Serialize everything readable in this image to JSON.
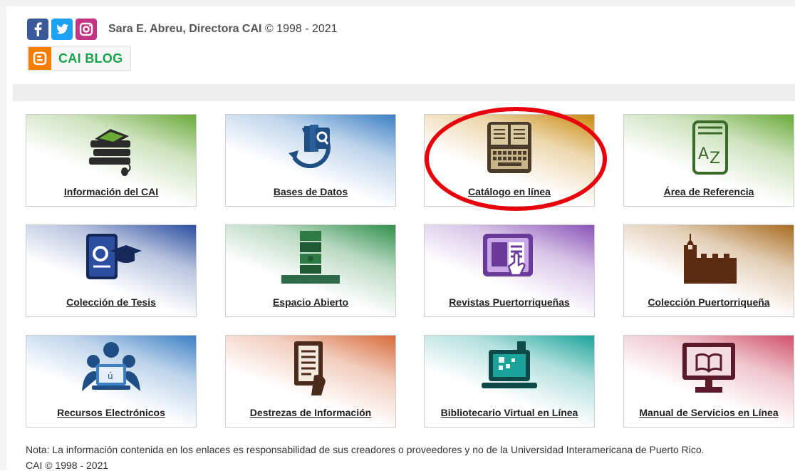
{
  "header": {
    "social": [
      {
        "name": "facebook-icon",
        "glyph": "f",
        "color": "#3b5998"
      },
      {
        "name": "twitter-icon",
        "color": "#1da1f2"
      },
      {
        "name": "instagram-icon",
        "color": "#c13584"
      }
    ],
    "credit_name": "Sara E. Abreu, Directora CAI",
    "credit_years": "© 1998 - 2021",
    "blog_label": "CAI BLOG"
  },
  "tiles": [
    {
      "label": "Información del CAI",
      "icon": "books-mouse-icon",
      "color": "#6aaa3a"
    },
    {
      "label": "Bases de Datos",
      "icon": "database-search-icon",
      "color": "#3b7fc4"
    },
    {
      "label": "Catálogo en línea",
      "icon": "book-keyboard-icon",
      "color": "#c98a0d"
    },
    {
      "label": "Área de Referencia",
      "icon": "dictionary-az-icon",
      "color": "#6aaa3a"
    },
    {
      "label": "Colección de Tesis",
      "icon": "thesis-gradcap-icon",
      "color": "#2b4ea0"
    },
    {
      "label": "Espacio Abierto",
      "icon": "open-space-icon",
      "color": "#2f8f4a"
    },
    {
      "label": "Revistas Puertorriqueñas",
      "icon": "magazine-touch-icon",
      "color": "#8a52b8"
    },
    {
      "label": "Colección Puertorriqueña",
      "icon": "castle-icon",
      "color": "#a86a1e"
    },
    {
      "label": "Recursos Electrónicos",
      "icon": "users-laptop-icon",
      "color": "#3b7fc4"
    },
    {
      "label": "Destrezas de Información",
      "icon": "document-hand-icon",
      "color": "#d86a3a"
    },
    {
      "label": "Bibliotecario Virtual en Línea",
      "icon": "virtual-laptop-icon",
      "color": "#1aa39a"
    },
    {
      "label": "Manual de Servicios en Línea",
      "icon": "monitor-book-icon",
      "color": "#d0506a"
    }
  ],
  "footer": {
    "note": "Nota: La información contenida en los enlaces es responsabilidad de sus creadores o proveedores y no de la Universidad Interamericana de Puerto Rico.",
    "copyright": "CAI © 1998 - 2021"
  },
  "annotation": {
    "highlight_color": "#e8000c"
  }
}
